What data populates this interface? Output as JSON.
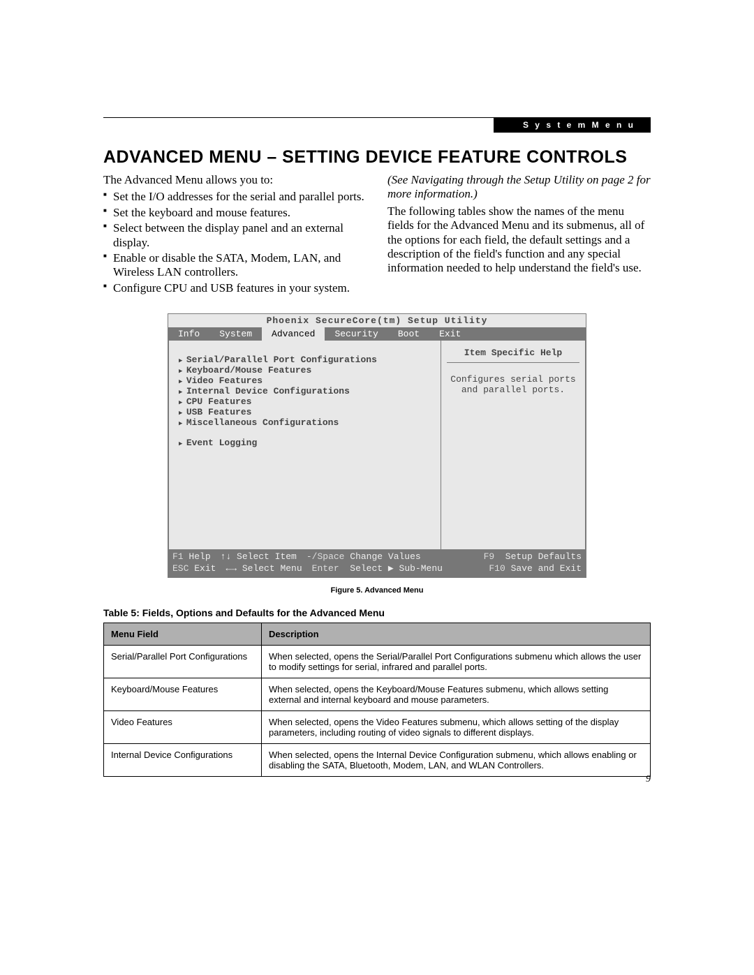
{
  "header": {
    "tab": "S y s t e m   M e n u"
  },
  "title": "ADVANCED MENU – SETTING DEVICE FEATURE CONTROLS",
  "intro": "The Advanced Menu allows you to:",
  "bullets": [
    "Set the I/O addresses for the serial and parallel ports.",
    "Set the keyboard and mouse features.",
    "Select between the display panel and an external display.",
    "Enable or disable the SATA, Modem, LAN, and Wireless LAN controllers.",
    "Configure CPU and USB features in your system."
  ],
  "right_col": {
    "see_nav": "(See Navigating through the Setup Utility on page 2 for more information.)",
    "desc": "The following tables show the names of the menu fields for the Advanced Menu and its submenus, all of the options for each field, the default settings and a description of the field's function and any special information needed to help understand the field's use."
  },
  "bios": {
    "utility_title": "Phoenix SecureCore(tm) Setup Utility",
    "tabs": [
      "Info",
      "System",
      "Advanced",
      "Security",
      "Boot",
      "Exit"
    ],
    "active_tab": "Advanced",
    "menu_items_1": [
      "Serial/Parallel Port Configurations",
      "Keyboard/Mouse Features",
      "Video Features",
      "Internal Device Configurations",
      "CPU Features",
      "USB Features",
      "Miscellaneous Configurations"
    ],
    "menu_items_2": [
      "Event Logging"
    ],
    "help_title": "Item Specific Help",
    "help_body": "Configures serial ports and parallel ports.",
    "footer": {
      "r1": {
        "f1": "F1",
        "help": "Help",
        "updown": "↑↓ Select Item",
        "minus": "-/Space",
        "change": "Change Values",
        "f9": "F9",
        "defaults": "Setup Defaults"
      },
      "r2": {
        "esc": "ESC",
        "exit": "Exit",
        "lr": "←→ Select Menu",
        "enter": "Enter",
        "sub": "Select ▶ Sub-Menu",
        "f10": "F10",
        "save": "Save and Exit"
      }
    }
  },
  "figure_caption": "Figure 5.  Advanced Menu",
  "table_caption": "Table 5: Fields, Options and Defaults for the Advanced Menu",
  "table": {
    "col1": "Menu Field",
    "col2": "Description",
    "rows": [
      {
        "f": "Serial/Parallel Port Configurations",
        "d": "When selected, opens the Serial/Parallel Port Configurations submenu which allows the user to modify settings for serial, infrared and parallel ports."
      },
      {
        "f": "Keyboard/Mouse Features",
        "d": "When selected, opens the Keyboard/Mouse Features submenu, which allows setting external and internal keyboard and mouse parameters."
      },
      {
        "f": "Video Features",
        "d": "When selected, opens the Video Features submenu, which allows setting of the display parameters, including routing of video signals to different displays."
      },
      {
        "f": "Internal Device Configurations",
        "d": "When selected, opens the Internal Device Configuration submenu, which allows enabling or disabling the SATA, Bluetooth, Modem, LAN, and WLAN Controllers."
      }
    ]
  },
  "page_number": "9"
}
